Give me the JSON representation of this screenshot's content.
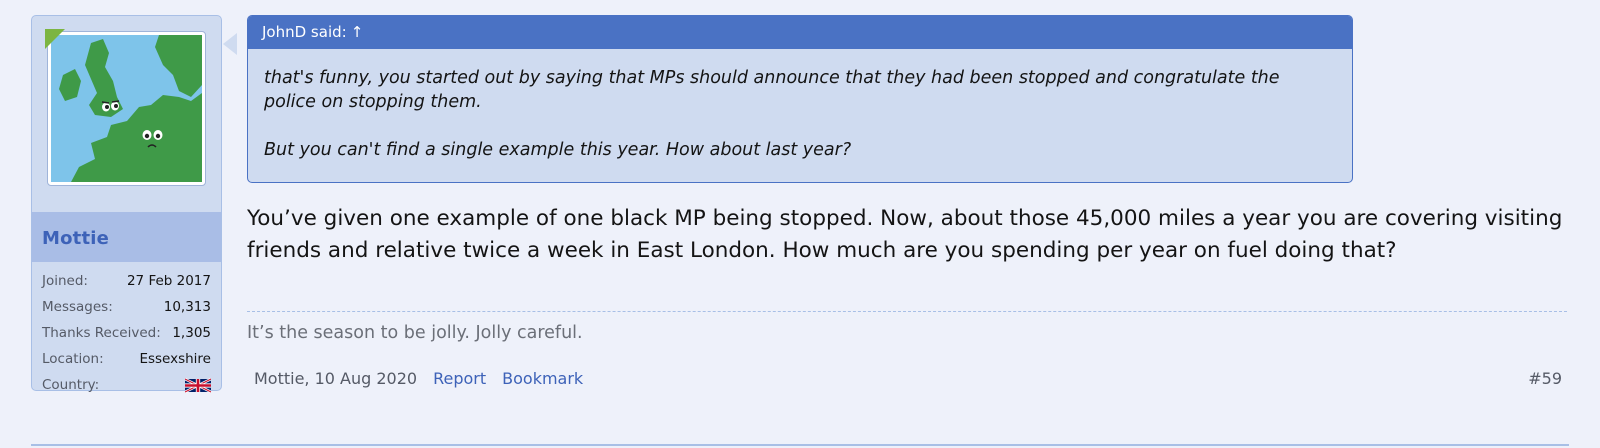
{
  "user": {
    "name": "Mottie",
    "avatar": "europe-map-avatar",
    "stats": [
      {
        "label": "Joined:",
        "value": "27 Feb 2017"
      },
      {
        "label": "Messages:",
        "value": "10,313"
      },
      {
        "label": "Thanks Received:",
        "value": "1,305"
      },
      {
        "label": "Location:",
        "value": "Essexshire"
      },
      {
        "label": "Country:",
        "value": "",
        "icon": "uk-flag-icon"
      }
    ]
  },
  "quote": {
    "author": "JohnD said:",
    "jump_icon": "↑",
    "paragraphs": [
      "that's funny, you started out by saying that MPs should announce that they had been stopped and congratulate the police on stopping them.",
      "But you can't find a single example this year. How about last year?"
    ]
  },
  "message": {
    "text": "You’ve given one example of one black MP being stopped. Now, about those 45,000 miles a year you are covering visiting friends and relative twice a week in East London. How much are you spending per year on fuel doing that?"
  },
  "signature": "It’s the season to be jolly. Jolly careful.",
  "footer": {
    "meta": "Mottie, 10 Aug 2020",
    "report": "Report",
    "bookmark": "Bookmark",
    "post_number": "#59"
  },
  "colors": {
    "accent": "#4a72c4",
    "panel": "#cfdbf0",
    "username": "#3d62b8",
    "background": "#eef1fa"
  }
}
